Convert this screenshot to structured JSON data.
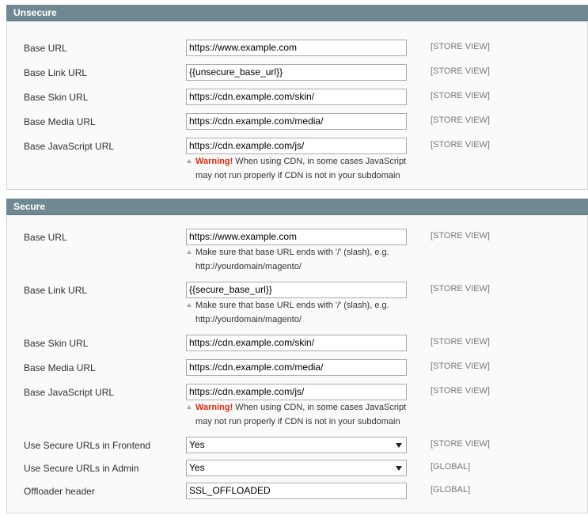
{
  "unsecure": {
    "title": "Unsecure",
    "rows": [
      {
        "label": "Base URL",
        "value": "https://www.example.com",
        "scope": "[STORE VIEW]"
      },
      {
        "label": "Base Link URL",
        "value": "{{unsecure_base_url}}",
        "scope": "[STORE VIEW]"
      },
      {
        "label": "Base Skin URL",
        "value": "https://cdn.example.com/skin/",
        "scope": "[STORE VIEW]"
      },
      {
        "label": "Base Media URL",
        "value": "https://cdn.example.com/media/",
        "scope": "[STORE VIEW]"
      },
      {
        "label": "Base JavaScript URL",
        "value": "https://cdn.example.com/js/",
        "scope": "[STORE VIEW]",
        "note": {
          "warning": "Warning!",
          "line1": " When using CDN, in some cases JavaScript",
          "line2": "may not run properly if CDN is not in your subdomain"
        }
      }
    ]
  },
  "secure": {
    "title": "Secure",
    "rows": [
      {
        "label": "Base URL",
        "value": "https://www.example.com",
        "scope": "[STORE VIEW]",
        "note": {
          "line1": "Make sure that base URL ends with '/' (slash), e.g.",
          "line2": "http://yourdomain/magento/"
        }
      },
      {
        "label": "Base Link URL",
        "value": "{{secure_base_url}}",
        "scope": "[STORE VIEW]",
        "note": {
          "line1": "Make sure that base URL ends with '/' (slash), e.g.",
          "line2": "http://yourdomain/magento/"
        }
      },
      {
        "label": "Base Skin URL",
        "value": "https://cdn.example.com/skin/",
        "scope": "[STORE VIEW]"
      },
      {
        "label": "Base Media URL",
        "value": "https://cdn.example.com/media/",
        "scope": "[STORE VIEW]"
      },
      {
        "label": "Base JavaScript URL",
        "value": "https://cdn.example.com/js/",
        "scope": "[STORE VIEW]",
        "note": {
          "warning": "Warning!",
          "line1": " When using CDN, in some cases JavaScript",
          "line2": "may not run properly if CDN is not in your subdomain"
        }
      },
      {
        "label": "Use Secure URLs in Frontend",
        "value": "Yes",
        "scope": "[STORE VIEW]"
      },
      {
        "label": "Use Secure URLs in Admin",
        "value": "Yes",
        "scope": "[GLOBAL]"
      },
      {
        "label": "Offloader header",
        "value": "SSL_OFFLOADED",
        "scope": "[GLOBAL]"
      }
    ]
  },
  "icons": {
    "note": "warning-triangle-icon",
    "dropdown": "chevron-down-icon"
  }
}
